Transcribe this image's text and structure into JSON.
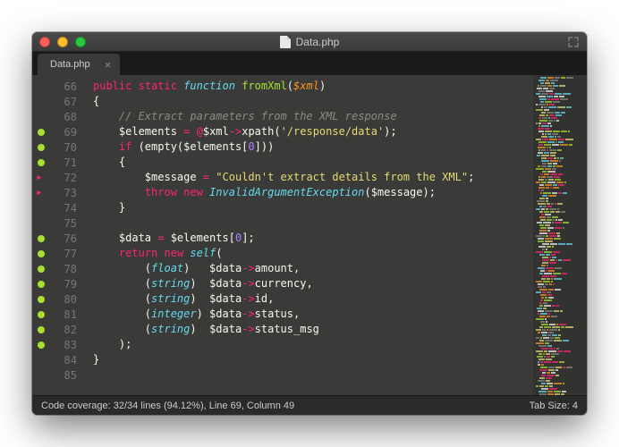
{
  "window": {
    "title": "Data.php"
  },
  "tabs": [
    {
      "label": "Data.php"
    }
  ],
  "gutter": {
    "lines": [
      {
        "n": "66"
      },
      {
        "n": "67"
      },
      {
        "n": "68"
      },
      {
        "n": "69",
        "mark": "green"
      },
      {
        "n": "70",
        "mark": "green"
      },
      {
        "n": "71",
        "mark": "green"
      },
      {
        "n": "72",
        "mark": "arrow"
      },
      {
        "n": "73",
        "mark": "arrow"
      },
      {
        "n": "74"
      },
      {
        "n": "75"
      },
      {
        "n": "76",
        "mark": "green"
      },
      {
        "n": "77",
        "mark": "green"
      },
      {
        "n": "78",
        "mark": "green"
      },
      {
        "n": "79",
        "mark": "green"
      },
      {
        "n": "80",
        "mark": "green"
      },
      {
        "n": "81",
        "mark": "green"
      },
      {
        "n": "82",
        "mark": "green"
      },
      {
        "n": "83",
        "mark": "green"
      },
      {
        "n": "84"
      },
      {
        "n": "85"
      }
    ]
  },
  "code": {
    "l66": {
      "public": "public",
      "static": "static",
      "function": "function",
      "name": "fromXml",
      "param": "$xml"
    },
    "l67": "{",
    "l68": "// Extract parameters from the XML response",
    "l69": {
      "elements": "$elements",
      "xml": "$xml",
      "xpath": "xpath",
      "path": "'/response/data'"
    },
    "l70": {
      "if": "if",
      "empty": "empty",
      "elements": "$elements",
      "idx": "0"
    },
    "l71": "{",
    "l72": {
      "msg": "$message",
      "str": "\"Couldn't extract details from the XML\""
    },
    "l73": {
      "throw": "throw",
      "new": "new",
      "exc": "InvalidArgumentException",
      "arg": "$message"
    },
    "l74": "}",
    "l76": {
      "data": "$data",
      "elements": "$elements",
      "idx": "0"
    },
    "l77": {
      "return": "return",
      "new": "new",
      "self": "self"
    },
    "l78": {
      "cast": "float",
      "data": "$data",
      "prop": "amount"
    },
    "l79": {
      "cast": "string",
      "data": "$data",
      "prop": "currency"
    },
    "l80": {
      "cast": "string",
      "data": "$data",
      "prop": "id"
    },
    "l81": {
      "cast": "integer",
      "data": "$data",
      "prop": "status"
    },
    "l82": {
      "cast": "string",
      "data": "$data",
      "prop": "status_msg"
    },
    "l83": ");",
    "l84": "}"
  },
  "status": {
    "left": "Code coverage: 32/34 lines (94.12%), Line 69, Column 49",
    "right": "Tab Size: 4"
  }
}
